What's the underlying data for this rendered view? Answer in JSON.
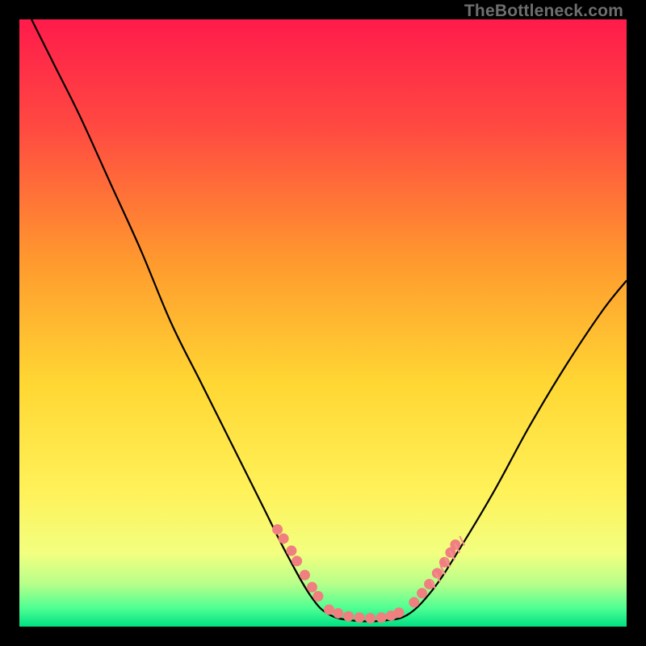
{
  "watermark": "TheBottleneck.com",
  "chart_data": {
    "type": "line",
    "title": "",
    "xlabel": "",
    "ylabel": "",
    "xlim": [
      0,
      100
    ],
    "ylim": [
      0,
      100
    ],
    "grid": false,
    "legend": false,
    "gradient_stops": [
      {
        "pct": 0,
        "color": "#ff1b4b"
      },
      {
        "pct": 18,
        "color": "#ff4a41"
      },
      {
        "pct": 40,
        "color": "#ff9a2e"
      },
      {
        "pct": 60,
        "color": "#ffd733"
      },
      {
        "pct": 78,
        "color": "#fff25a"
      },
      {
        "pct": 88,
        "color": "#f2ff80"
      },
      {
        "pct": 93,
        "color": "#b6ff8a"
      },
      {
        "pct": 97,
        "color": "#4dff93"
      },
      {
        "pct": 100,
        "color": "#00e082"
      }
    ],
    "series": [
      {
        "name": "bottleneck-curve",
        "stroke": "#000000",
        "points": [
          {
            "x": 2,
            "y": 100
          },
          {
            "x": 6,
            "y": 92
          },
          {
            "x": 10,
            "y": 84
          },
          {
            "x": 15,
            "y": 73
          },
          {
            "x": 20,
            "y": 62
          },
          {
            "x": 25,
            "y": 50
          },
          {
            "x": 30,
            "y": 40
          },
          {
            "x": 35,
            "y": 30
          },
          {
            "x": 40,
            "y": 20
          },
          {
            "x": 44,
            "y": 12
          },
          {
            "x": 48,
            "y": 5
          },
          {
            "x": 51,
            "y": 2
          },
          {
            "x": 55,
            "y": 1
          },
          {
            "x": 60,
            "y": 1
          },
          {
            "x": 64,
            "y": 2
          },
          {
            "x": 68,
            "y": 6
          },
          {
            "x": 72,
            "y": 12
          },
          {
            "x": 78,
            "y": 22
          },
          {
            "x": 84,
            "y": 33
          },
          {
            "x": 90,
            "y": 43
          },
          {
            "x": 96,
            "y": 52
          },
          {
            "x": 100,
            "y": 57
          }
        ]
      },
      {
        "name": "marker-dots-left",
        "stroke": "#f08080",
        "points": [
          {
            "x": 42.5,
            "y": 16
          },
          {
            "x": 43.5,
            "y": 14.5
          },
          {
            "x": 44.8,
            "y": 12.5
          },
          {
            "x": 45.7,
            "y": 10.8
          },
          {
            "x": 47,
            "y": 8.5
          },
          {
            "x": 48.2,
            "y": 6.5
          },
          {
            "x": 49.2,
            "y": 5
          }
        ]
      },
      {
        "name": "marker-dots-bottom",
        "stroke": "#f08080",
        "points": [
          {
            "x": 51,
            "y": 2.8
          },
          {
            "x": 52.5,
            "y": 2.2
          },
          {
            "x": 54.2,
            "y": 1.7
          },
          {
            "x": 56,
            "y": 1.5
          },
          {
            "x": 57.8,
            "y": 1.4
          },
          {
            "x": 59.6,
            "y": 1.5
          },
          {
            "x": 61.2,
            "y": 1.8
          },
          {
            "x": 62.5,
            "y": 2.3
          }
        ]
      },
      {
        "name": "marker-dots-right",
        "stroke": "#f08080",
        "points": [
          {
            "x": 65,
            "y": 4
          },
          {
            "x": 66.3,
            "y": 5.5
          },
          {
            "x": 67.5,
            "y": 7
          },
          {
            "x": 68.8,
            "y": 8.8
          },
          {
            "x": 70,
            "y": 10.6
          },
          {
            "x": 71,
            "y": 12.2
          },
          {
            "x": 71.8,
            "y": 13.5
          }
        ]
      },
      {
        "name": "hatch-ticks-right",
        "stroke": "#f49090",
        "ticks": [
          {
            "x": 67.5,
            "y": 6.5
          },
          {
            "x": 68.3,
            "y": 7.6
          },
          {
            "x": 69.1,
            "y": 8.8
          },
          {
            "x": 69.9,
            "y": 10
          },
          {
            "x": 70.7,
            "y": 11.2
          },
          {
            "x": 71.5,
            "y": 12.4
          },
          {
            "x": 72.3,
            "y": 13.6
          }
        ]
      }
    ]
  }
}
